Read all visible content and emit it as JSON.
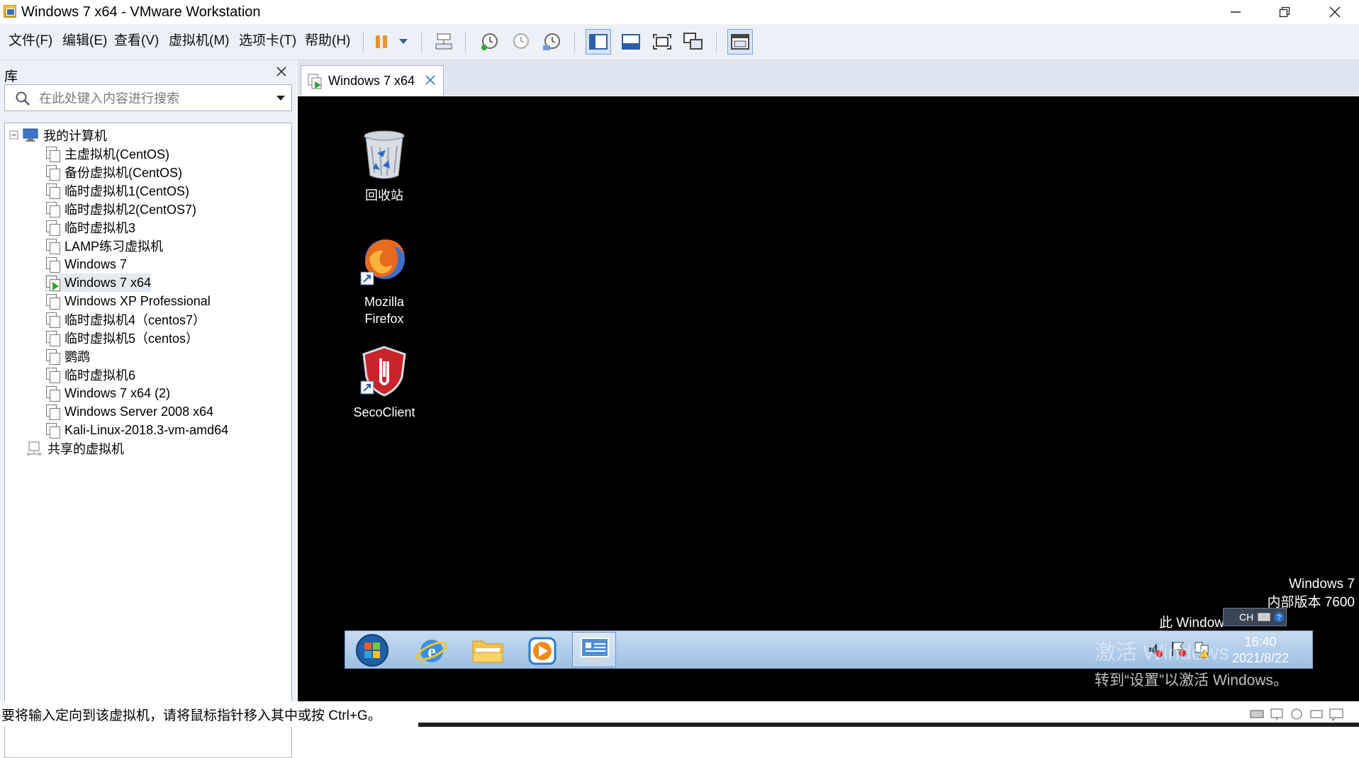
{
  "window": {
    "title": "Windows 7 x64 - VMware Workstation"
  },
  "menu": {
    "items": [
      "文件(F)",
      "编辑(E)",
      "查看(V)",
      "虚拟机(M)",
      "选项卡(T)",
      "帮助(H)"
    ]
  },
  "library": {
    "title": "库",
    "search_placeholder": "在此处键入内容进行搜索",
    "root": "我的计算机",
    "vms": [
      "主虚拟机(CentOS)",
      "备份虚拟机(CentOS)",
      "临时虚拟机1(CentOS)",
      "临时虚拟机2(CentOS7)",
      "临时虚拟机3",
      "LAMP练习虚拟机",
      "Windows 7",
      "Windows 7 x64",
      "Windows XP Professional",
      "临时虚拟机4（centos7）",
      "临时虚拟机5（centos）",
      "鹦鹉",
      "临时虚拟机6",
      "Windows 7 x64 (2)",
      "Windows Server 2008 x64",
      "Kali-Linux-2018.3-vm-amd64"
    ],
    "shared": "共享的虚拟机",
    "selected_vm": "Windows 7 x64"
  },
  "tab": {
    "label": "Windows 7 x64"
  },
  "guest": {
    "desktop_icons": [
      {
        "label_lines": [
          "回收站"
        ]
      },
      {
        "label_lines": [
          "Mozilla",
          "Firefox"
        ]
      },
      {
        "label_lines": [
          "SecoClient"
        ]
      }
    ],
    "watermark": {
      "line1": "Windows 7",
      "line2": "内部版本 7600",
      "line3": "此 Window",
      "activate1": "激活 Windows",
      "activate2": "转到“设置”以激活 Windows。"
    },
    "langbar": {
      "lang": "CH"
    },
    "clock": {
      "time": "16:40",
      "date": "2021/8/22"
    }
  },
  "status": {
    "text": "要将输入定向到该虚拟机，请将鼠标指针移入其中或按 Ctrl+G。"
  },
  "colors": {
    "accent": "#3b7fc4",
    "toolbar_bg": "#ecf1f8",
    "taskbar": "#a9c6e6",
    "pause": "#e8952a",
    "run_green": "#2fa82f"
  }
}
